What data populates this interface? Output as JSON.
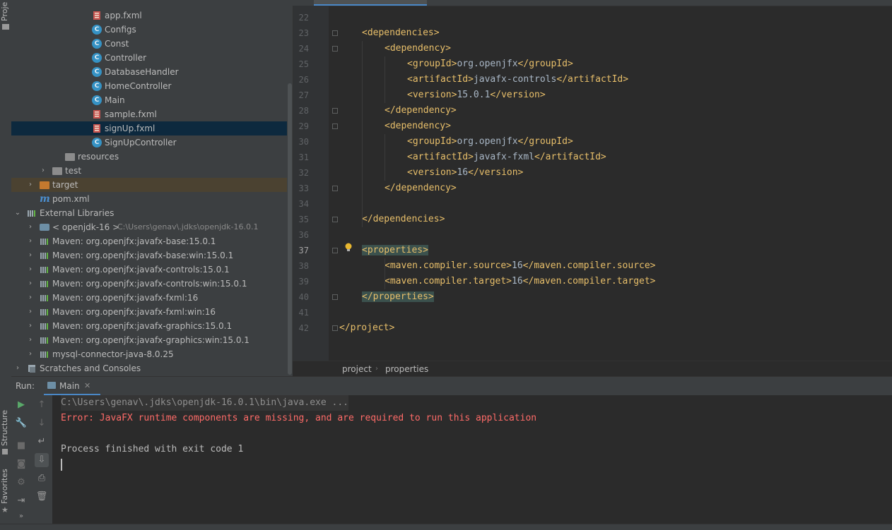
{
  "sidebar": {
    "tabs": {
      "project": "Proje",
      "structure": "Structure",
      "favorites": "Favorites"
    }
  },
  "project_tree": {
    "rows": [
      {
        "label": "app.fxml",
        "icon": "fxml-file-icon"
      },
      {
        "label": "Configs",
        "icon": "class-icon"
      },
      {
        "label": "Const",
        "icon": "class-icon"
      },
      {
        "label": "Controller",
        "icon": "class-icon"
      },
      {
        "label": "DatabaseHandler",
        "icon": "class-icon"
      },
      {
        "label": "HomeController",
        "icon": "class-icon"
      },
      {
        "label": "Main",
        "icon": "main-class-icon"
      },
      {
        "label": "sample.fxml",
        "icon": "fxml-file-icon"
      },
      {
        "label": "signUp.fxml",
        "icon": "fxml-file-icon",
        "selected": true
      },
      {
        "label": "SignUpController",
        "icon": "class-icon"
      },
      {
        "label": "resources",
        "icon": "resources-folder-icon"
      },
      {
        "label": "test",
        "icon": "folder-icon"
      },
      {
        "label": "target",
        "icon": "excluded-folder-icon",
        "highlighted": true
      },
      {
        "label": "pom.xml",
        "icon": "maven-icon"
      },
      {
        "label": "External Libraries",
        "icon": "library-icon"
      },
      {
        "label": "< openjdk-16 >",
        "hint": "C:\\Users\\genav\\.jdks\\openjdk-16.0.1",
        "icon": "jdk-icon"
      },
      {
        "label": "Maven: org.openjfx:javafx-base:15.0.1",
        "icon": "library-icon"
      },
      {
        "label": "Maven: org.openjfx:javafx-base:win:15.0.1",
        "icon": "library-icon"
      },
      {
        "label": "Maven: org.openjfx:javafx-controls:15.0.1",
        "icon": "library-icon"
      },
      {
        "label": "Maven: org.openjfx:javafx-controls:win:15.0.1",
        "icon": "library-icon"
      },
      {
        "label": "Maven: org.openjfx:javafx-fxml:16",
        "icon": "library-icon"
      },
      {
        "label": "Maven: org.openjfx:javafx-fxml:win:16",
        "icon": "library-icon"
      },
      {
        "label": "Maven: org.openjfx:javafx-graphics:15.0.1",
        "icon": "library-icon"
      },
      {
        "label": "Maven: org.openjfx:javafx-graphics:win:15.0.1",
        "icon": "library-icon"
      },
      {
        "label": "mysql-connector-java-8.0.25",
        "icon": "library-icon"
      },
      {
        "label": "Scratches and Consoles",
        "icon": "scratches-icon"
      }
    ]
  },
  "editor": {
    "lines": [
      {
        "n": "22",
        "code": ""
      },
      {
        "n": "23",
        "code": "<dependencies>"
      },
      {
        "n": "24",
        "code": "<dependency>"
      },
      {
        "n": "25",
        "open": "<groupId>",
        "text": "org.openjfx",
        "close": "</groupId>"
      },
      {
        "n": "26",
        "open": "<artifactId>",
        "text": "javafx-controls",
        "close": "</artifactId>"
      },
      {
        "n": "27",
        "open": "<version>",
        "text": "15.0.1",
        "close": "</version>"
      },
      {
        "n": "28",
        "code": "</dependency>"
      },
      {
        "n": "29",
        "code": "<dependency>"
      },
      {
        "n": "30",
        "open": "<groupId>",
        "text": "org.openjfx",
        "close": "</groupId>"
      },
      {
        "n": "31",
        "open": "<artifactId>",
        "text": "javafx-fxml",
        "close": "</artifactId>"
      },
      {
        "n": "32",
        "open": "<version>",
        "text": "16",
        "close": "</version>"
      },
      {
        "n": "33",
        "code": "</dependency>"
      },
      {
        "n": "34",
        "code": ""
      },
      {
        "n": "35",
        "code": "</dependencies>"
      },
      {
        "n": "36",
        "code": ""
      },
      {
        "n": "37",
        "code": "<properties>"
      },
      {
        "n": "38",
        "open": "<maven.compiler.source>",
        "text": "16",
        "close": "</maven.compiler.source>"
      },
      {
        "n": "39",
        "open": "<maven.compiler.target>",
        "text": "16",
        "close": "</maven.compiler.target>"
      },
      {
        "n": "40",
        "code": "</properties>"
      },
      {
        "n": "41",
        "code": ""
      },
      {
        "n": "42",
        "code": "</project>"
      }
    ],
    "breadcrumb": [
      "project",
      "properties"
    ]
  },
  "run_panel": {
    "label": "Run:",
    "tab": "Main",
    "console": [
      "C:\\Users\\genav\\.jdks\\openjdk-16.0.1\\bin\\java.exe ...",
      "Error: JavaFX runtime components are missing, and are required to run this application",
      "",
      "Process finished with exit code 1"
    ]
  },
  "colors": {
    "tag": "#e8bf6a",
    "text": "#a9b7c6",
    "error": "#ff6b68",
    "selection": "#0d293e",
    "accent": "#4a88c7"
  }
}
